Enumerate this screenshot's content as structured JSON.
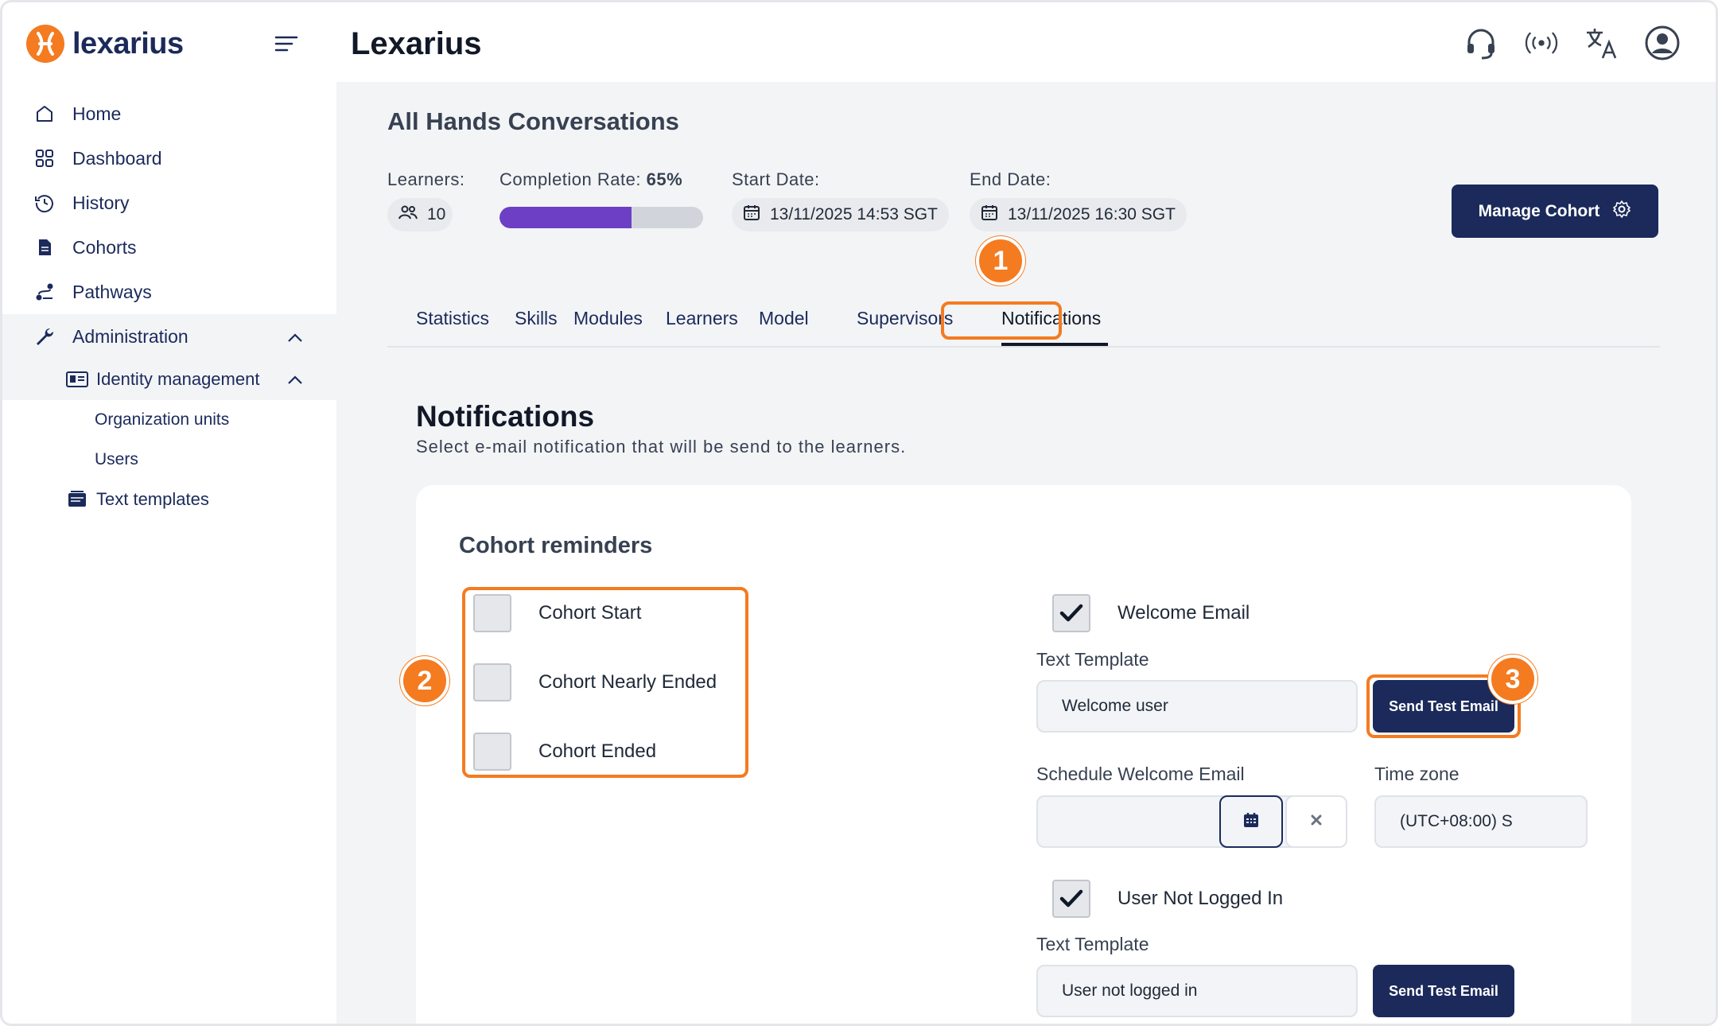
{
  "brand": {
    "name": "lexarius",
    "accent": "#f47b20",
    "navy": "#1b2a5b"
  },
  "sidebar": {
    "items": [
      {
        "label": "Home",
        "icon": "home-icon"
      },
      {
        "label": "Dashboard",
        "icon": "grid-icon"
      },
      {
        "label": "History",
        "icon": "history-icon"
      },
      {
        "label": "Cohorts",
        "icon": "document-icon"
      },
      {
        "label": "Pathways",
        "icon": "pathway-icon"
      },
      {
        "label": "Administration",
        "icon": "wrench-icon"
      }
    ],
    "admin_children": {
      "identity_label": "Identity management",
      "identity_children": [
        "Organization units",
        "Users"
      ],
      "text_templates_label": "Text templates"
    }
  },
  "header": {
    "title": "Lexarius",
    "icons": [
      "headset-icon",
      "broadcast-icon",
      "translate-icon",
      "user-account-icon"
    ]
  },
  "cohort": {
    "title": "All Hands Conversations",
    "learners_label": "Learners:",
    "learners_count": "10",
    "completion_label": "Completion Rate:",
    "completion_value": "65%",
    "completion_fraction": 0.65,
    "start_label": "Start Date:",
    "start_value": "13/11/2025 14:53 SGT",
    "end_label": "End Date:",
    "end_value": "13/11/2025 16:30 SGT",
    "manage_label": "Manage Cohort"
  },
  "tabs": [
    "Statistics",
    "Skills",
    "Modules",
    "Learners",
    "Model",
    "Supervisors",
    "Notifications"
  ],
  "active_tab": "Notifications",
  "notifications": {
    "title": "Notifications",
    "subtitle": "Select e-mail notification that will be send to the learners.",
    "card_title": "Cohort reminders",
    "reminders": [
      {
        "label": "Cohort Start",
        "checked": false
      },
      {
        "label": "Cohort Nearly Ended",
        "checked": false
      },
      {
        "label": "Cohort Ended",
        "checked": false
      }
    ],
    "welcome": {
      "label": "Welcome Email",
      "checked": true,
      "template_label": "Text Template",
      "template_value": "Welcome user",
      "send_label": "Send Test Email",
      "schedule_label": "Schedule Welcome Email",
      "schedule_value": "",
      "timezone_label": "Time zone",
      "timezone_value": "(UTC+08:00) S"
    },
    "not_logged_in": {
      "label": "User Not Logged In",
      "checked": true,
      "template_label": "Text Template",
      "template_value": "User not logged in",
      "send_label": "Send Test Email"
    }
  },
  "callouts": [
    "1",
    "2",
    "3"
  ]
}
